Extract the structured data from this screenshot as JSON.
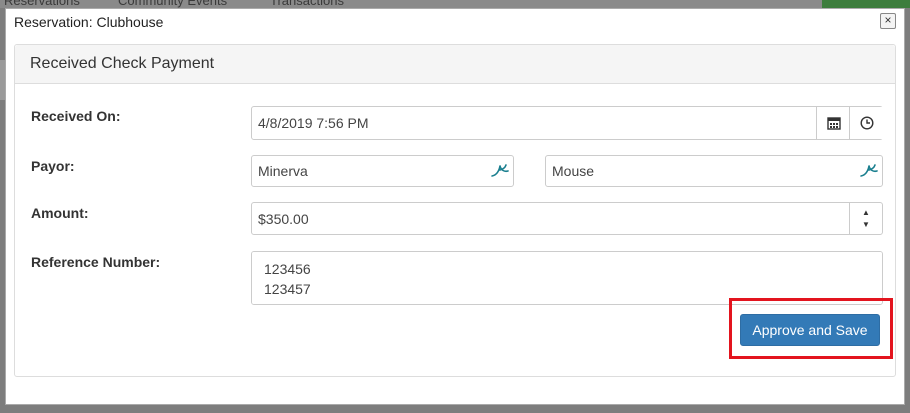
{
  "background": {
    "tabs": [
      "Reservations",
      "Community Events",
      "Transactions"
    ]
  },
  "dialog": {
    "title": "Reservation: Clubhouse",
    "close_glyph": "×"
  },
  "panel": {
    "heading": "Received Check Payment"
  },
  "form": {
    "received_on": {
      "label": "Received On:",
      "value": "4/8/2019 7:56 PM"
    },
    "payor": {
      "label": "Payor:",
      "first_name": "Minerva",
      "last_name": "Mouse"
    },
    "amount": {
      "label": "Amount:",
      "value": "$350.00"
    },
    "reference": {
      "label": "Reference Number:",
      "value": "123456\n123457"
    }
  },
  "actions": {
    "approve_label": "Approve and Save"
  },
  "colors": {
    "primary": "#337ab7",
    "highlight": "#e3141e",
    "lookup_icon": "#1a7f8f"
  },
  "icons": [
    "calendar-icon",
    "clock-icon",
    "lookup-icon",
    "spinner-up-icon",
    "spinner-down-icon",
    "close-icon"
  ]
}
